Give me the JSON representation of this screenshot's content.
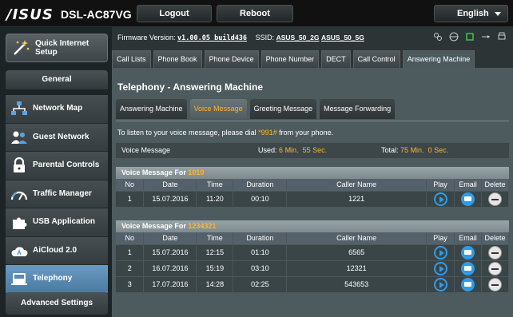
{
  "header": {
    "brand": "/ISUS",
    "model": "DSL-AC87VG",
    "logout_label": "Logout",
    "reboot_label": "Reboot",
    "language": "English"
  },
  "sidebar": {
    "quick_setup": "Quick Internet Setup",
    "general_header": "General",
    "advanced_header": "Advanced Settings",
    "items": [
      {
        "label": "Network Map",
        "icon": "network-map-icon"
      },
      {
        "label": "Guest Network",
        "icon": "guest-network-icon"
      },
      {
        "label": "Parental Controls",
        "icon": "lock-icon"
      },
      {
        "label": "Traffic Manager",
        "icon": "gauge-icon"
      },
      {
        "label": "USB Application",
        "icon": "puzzle-icon"
      },
      {
        "label": "AiCloud 2.0",
        "icon": "cloud-icon"
      },
      {
        "label": "Telephony",
        "icon": "phone-icon"
      }
    ]
  },
  "status": {
    "firmware_label": "Firmware Version:",
    "firmware": "v1.00.05_build436",
    "ssid_label": "SSID:",
    "ssid_2g": "ASUS_50_2G",
    "ssid_5g": "ASUS_50_5G"
  },
  "tabs": [
    "Call Lists",
    "Phone Book",
    "Phone Device",
    "Phone Number",
    "DECT",
    "Call Control",
    "Answering Machine"
  ],
  "panel": {
    "title": "Telephony - Answering Machine",
    "subtabs": [
      "Answering Machine",
      "Voice Message",
      "Greeting Message",
      "Message Forwarding"
    ],
    "hint_prefix": "To listen to your voice message, please dial ",
    "hint_code": "*991#",
    "hint_suffix": " from your phone.",
    "usage": {
      "label": "Voice Message",
      "used_label": "Used:",
      "used_value": "6",
      "used_min": "Min.",
      "used_sec_value": "55",
      "used_sec": "Sec.",
      "total_label": "Total:",
      "total_value": "75",
      "total_min": "Min.",
      "total_sec_value": "0",
      "total_sec": "Sec."
    }
  },
  "table_headers": [
    "No",
    "Date",
    "Time",
    "Duration",
    "Caller Name",
    "Play",
    "Email",
    "Delete"
  ],
  "groups": [
    {
      "title_prefix": "Voice Message For ",
      "number": "1010",
      "rows": [
        {
          "no": "1",
          "date": "15.07.2016",
          "time": "11:20",
          "duration": "00:10",
          "caller": "1221"
        }
      ]
    },
    {
      "title_prefix": "Voice Message For ",
      "number": "1234321",
      "rows": [
        {
          "no": "1",
          "date": "15.07.2016",
          "time": "12:15",
          "duration": "01:10",
          "caller": "6565"
        },
        {
          "no": "2",
          "date": "16.07.2016",
          "time": "15:19",
          "duration": "03:10",
          "caller": "12321"
        },
        {
          "no": "3",
          "date": "17.07.2016",
          "time": "14:28",
          "duration": "02:25",
          "caller": "543653"
        }
      ]
    }
  ],
  "colors": {
    "accent": "#ffb52e",
    "active_nav": "#5b8ab3",
    "play_blue": "#2f9be8"
  }
}
